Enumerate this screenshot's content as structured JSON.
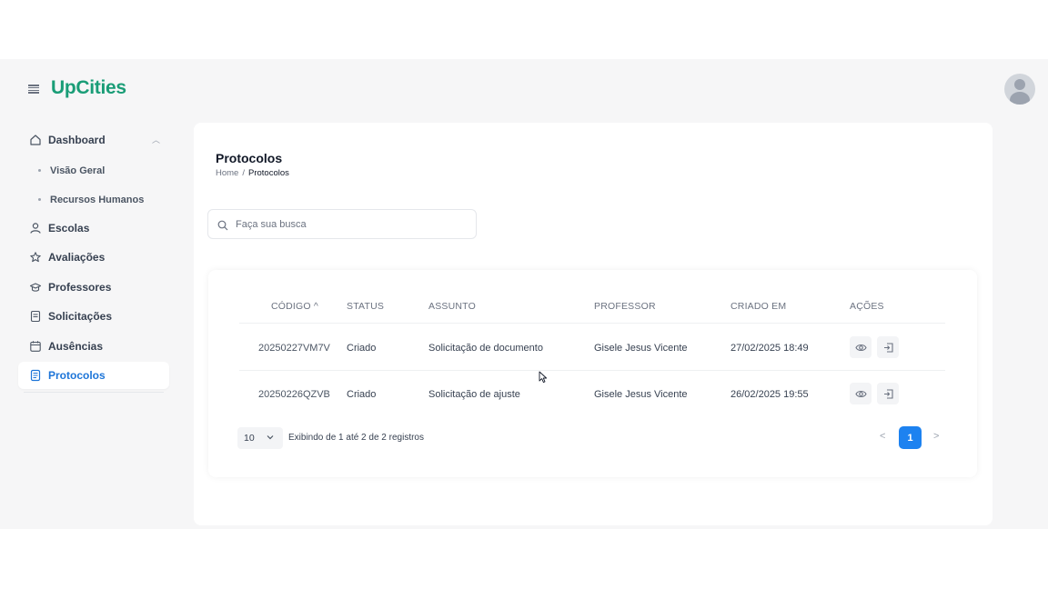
{
  "app": {
    "logo": "UpCities"
  },
  "sidebar": {
    "items": [
      {
        "label": "Dashboard",
        "icon": "home-icon"
      },
      {
        "label": "Visão Geral"
      },
      {
        "label": "Recursos Humanos"
      },
      {
        "label": "Escolas",
        "icon": "user-icon"
      },
      {
        "label": "Avaliações",
        "icon": "star-icon"
      },
      {
        "label": "Professores",
        "icon": "graduation-cap-icon"
      },
      {
        "label": "Solicitações",
        "icon": "document-icon"
      },
      {
        "label": "Ausências",
        "icon": "calendar-icon"
      },
      {
        "label": "Protocolos",
        "icon": "document-list-icon"
      }
    ]
  },
  "page": {
    "title": "Protocolos",
    "breadcrumb": {
      "home": "Home",
      "separator": "/",
      "current": "Protocolos"
    }
  },
  "search": {
    "placeholder": "Faça sua busca"
  },
  "table": {
    "headers": [
      "CÓDIGO",
      "STATUS",
      "ASSUNTO",
      "PROFESSOR",
      "CRIADO EM",
      "AÇÕES"
    ],
    "sort_indicator": "^",
    "rows": [
      {
        "codigo": "20250227VM7V",
        "status": "Criado",
        "assunto": "Solicitação de documento",
        "professor": "Gisele Jesus Vicente",
        "criado_em": "27/02/2025 18:49"
      },
      {
        "codigo": "20250226QZVB",
        "status": "Criado",
        "assunto": "Solicitação de ajuste",
        "professor": "Gisele Jesus Vicente",
        "criado_em": "26/02/2025 19:55"
      }
    ]
  },
  "pagination": {
    "page_size": "10",
    "info": "Exibindo de 1 até 2 de 2 registros",
    "prev": "<",
    "current": "1",
    "next": ">"
  },
  "colors": {
    "brand": "#1a9d77",
    "accent": "#1d82f0",
    "active_text": "#1d75d8"
  }
}
